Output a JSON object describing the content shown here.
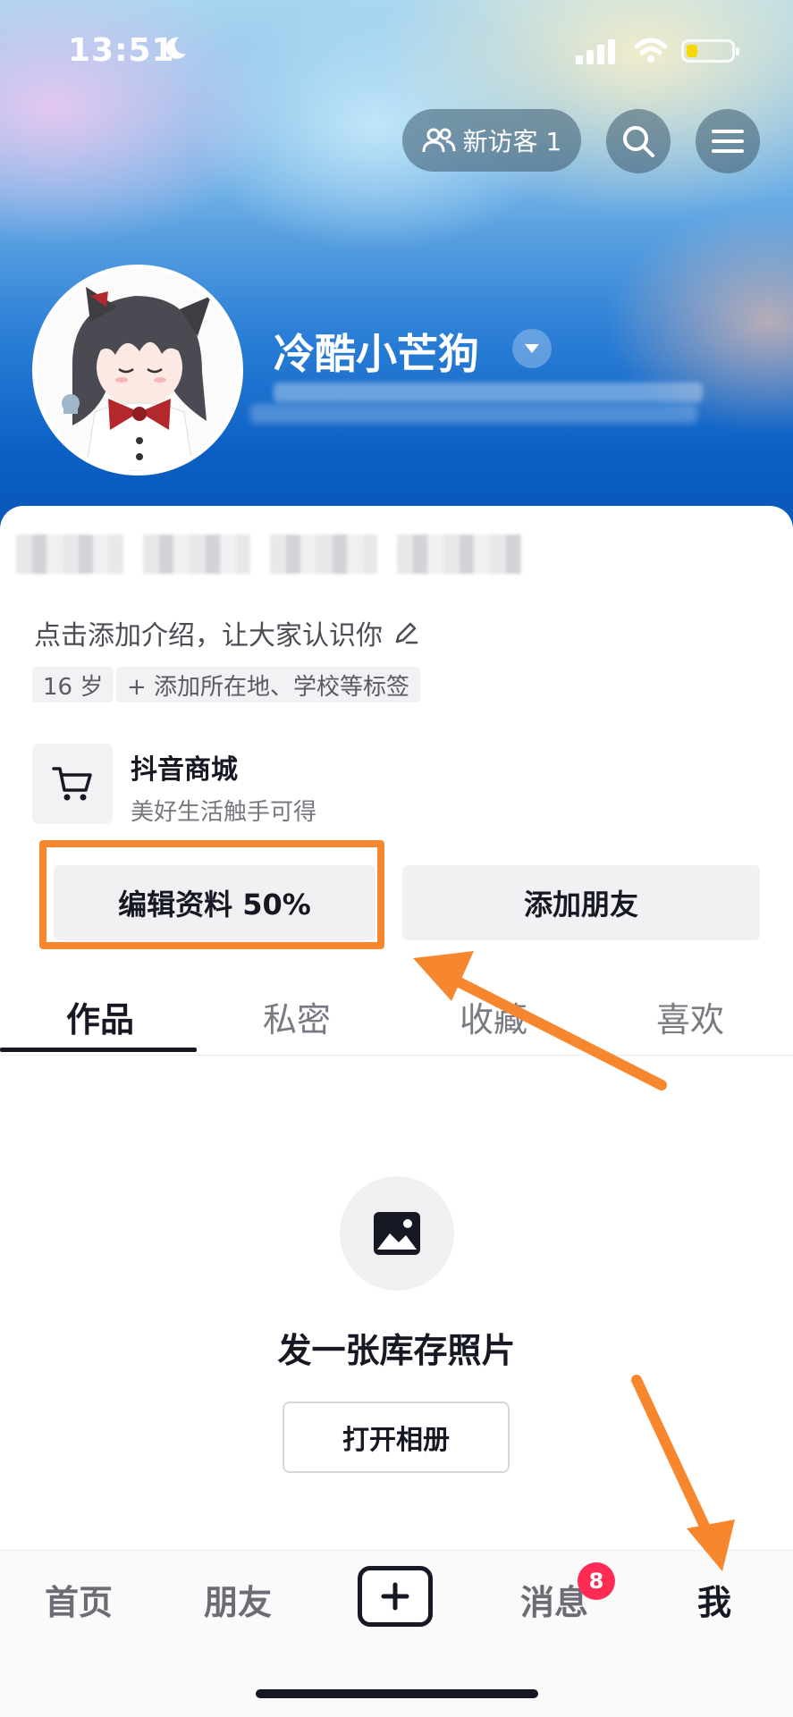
{
  "status_bar": {
    "time": "13:51"
  },
  "header": {
    "visitor_label": "新访客 1",
    "nickname": "冷酷小芒狗"
  },
  "profile": {
    "bio_placeholder": "点击添加介绍，让大家认识你",
    "tags": [
      "16 岁",
      "+ 添加所在地、学校等标签"
    ],
    "shop": {
      "title": "抖音商城",
      "subtitle": "美好生活触手可得"
    }
  },
  "actions": {
    "edit_profile": "编辑资料 50%",
    "add_friends": "添加朋友"
  },
  "tabs": [
    "作品",
    "私密",
    "收藏",
    "喜欢"
  ],
  "empty_state": {
    "title": "发一张库存照片",
    "button": "打开相册"
  },
  "bottom_nav": {
    "items": [
      "首页",
      "朋友",
      "消息",
      "我"
    ],
    "message_badge": "8"
  },
  "colors": {
    "annotation_orange": "#f7872e",
    "badge_red": "#fe2c55",
    "text_primary": "#161823"
  }
}
